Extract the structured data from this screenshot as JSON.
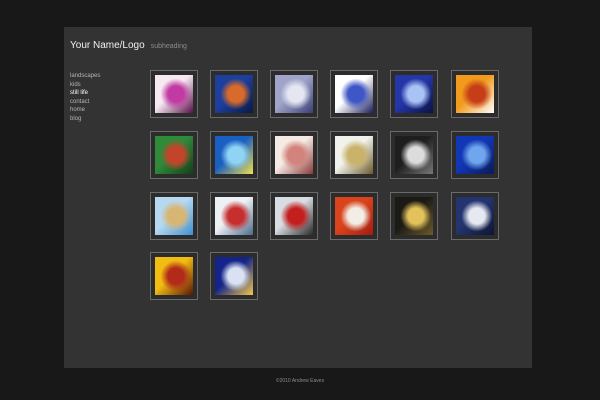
{
  "header": {
    "title": "Your Name/Logo",
    "subheading": "subheading"
  },
  "nav": {
    "items": [
      {
        "label": "landscapes",
        "name": "nav-landscapes",
        "active": false
      },
      {
        "label": "kids",
        "name": "nav-kids",
        "active": false
      },
      {
        "label": "still life",
        "name": "nav-still-life",
        "active": true
      },
      {
        "label": "contact",
        "name": "nav-contact",
        "active": false
      },
      {
        "label": "home",
        "name": "nav-home",
        "active": false
      },
      {
        "label": "blog",
        "name": "nav-blog",
        "active": false
      }
    ]
  },
  "gallery": {
    "thumbnails": [
      {
        "subject": "magenta-balloon-photo",
        "colors": [
          "#f6e9f2",
          "#c23aa3",
          "#5a0f4a"
        ]
      },
      {
        "subject": "blue-lava-lamp-photo",
        "colors": [
          "#1d3f9e",
          "#d86a2b",
          "#0a1a44"
        ]
      },
      {
        "subject": "open-book-photo",
        "colors": [
          "#9fa4c8",
          "#e4e6f2",
          "#3b3f77"
        ]
      },
      {
        "subject": "blue-bowl-photo",
        "colors": [
          "#ffffff",
          "#3f56c7",
          "#1a1f5c"
        ]
      },
      {
        "subject": "blue-glass-streak-photo",
        "colors": [
          "#2536a8",
          "#a9c3f5",
          "#0c1244"
        ]
      },
      {
        "subject": "sneaker-photo",
        "colors": [
          "#f19a1b",
          "#c63d18",
          "#ffffff"
        ]
      },
      {
        "subject": "table-football-photo",
        "colors": [
          "#2f8a3a",
          "#c4442b",
          "#173d1a"
        ]
      },
      {
        "subject": "lemon-drink-glass-photo",
        "colors": [
          "#1a5fc2",
          "#8fd4f5",
          "#f2e04a"
        ]
      },
      {
        "subject": "pink-soap-photo",
        "colors": [
          "#f5ebe4",
          "#d2837c",
          "#8a3a3a"
        ]
      },
      {
        "subject": "pear-photo",
        "colors": [
          "#f2f2ec",
          "#c9b26a",
          "#6b5a2a"
        ]
      },
      {
        "subject": "power-plug-photo",
        "colors": [
          "#1e1e1e",
          "#dcdcdc",
          "#777777"
        ]
      },
      {
        "subject": "blue-harmonica-photo",
        "colors": [
          "#1237b5",
          "#6fa6ee",
          "#091b57"
        ]
      },
      {
        "subject": "sandcastle-photo",
        "colors": [
          "#b6d9f1",
          "#d9b573",
          "#3f8fd1"
        ]
      },
      {
        "subject": "red-boat-photo",
        "colors": [
          "#eef1f4",
          "#c72e2e",
          "#4c6a8a"
        ]
      },
      {
        "subject": "red-stapler-photo",
        "colors": [
          "#d8dde2",
          "#c41f1f",
          "#2a2a2a"
        ]
      },
      {
        "subject": "thermometer-photo",
        "colors": [
          "#d9441d",
          "#f2eee5",
          "#a31c11"
        ]
      },
      {
        "subject": "glass-bottle-photo",
        "colors": [
          "#1c1a14",
          "#e3c25c",
          "#6b5a2a"
        ]
      },
      {
        "subject": "paper-folds-photo",
        "colors": [
          "#24346e",
          "#e6e9f2",
          "#0e1533"
        ]
      },
      {
        "subject": "red-wine-glass-photo",
        "colors": [
          "#f2bd12",
          "#b12a1a",
          "#5a1308"
        ]
      },
      {
        "subject": "blue-toy-photo",
        "colors": [
          "#15248a",
          "#d9e1f2",
          "#f2c84a"
        ]
      }
    ]
  },
  "footer": {
    "copyright": "©2010 Andrew Eaves"
  }
}
